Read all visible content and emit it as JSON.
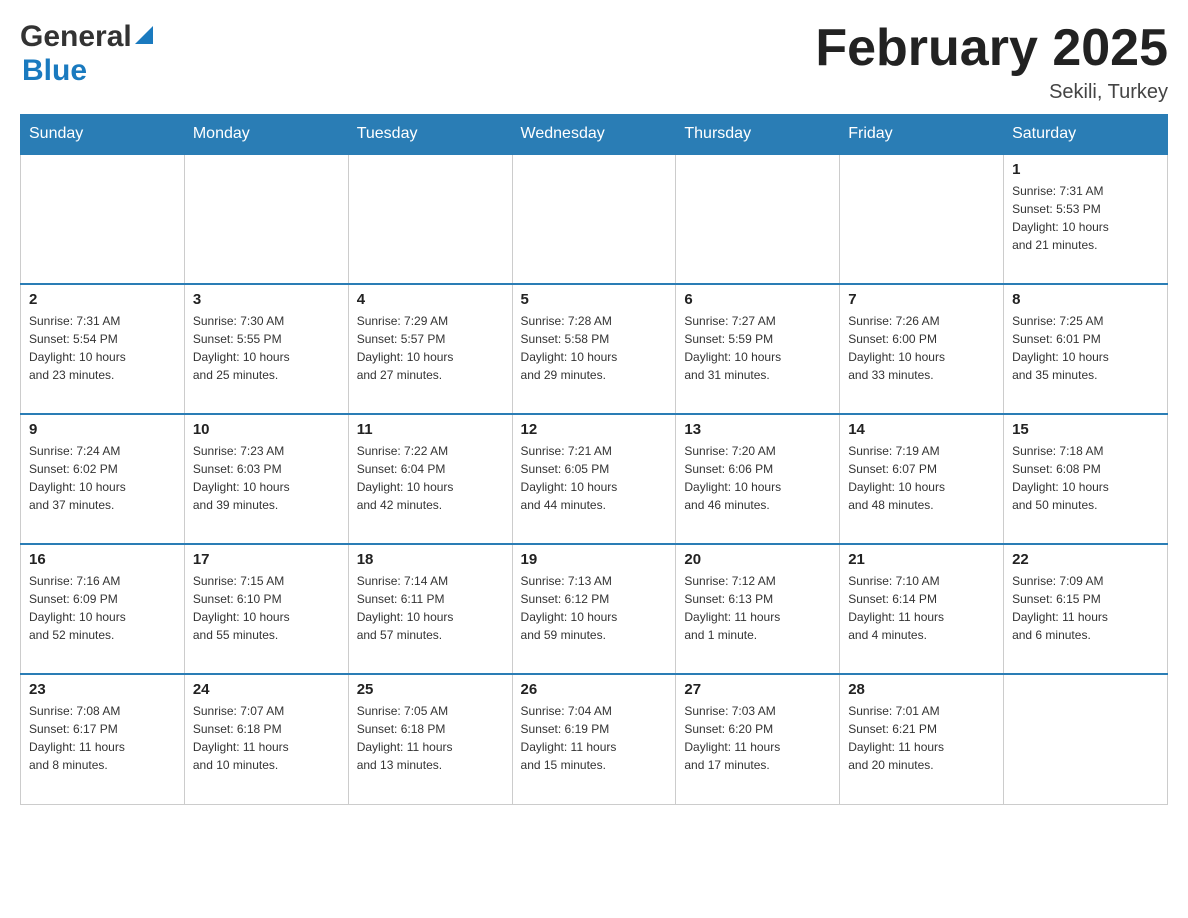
{
  "header": {
    "logo": {
      "general": "General",
      "blue": "Blue"
    },
    "title": "February 2025",
    "location": "Sekili, Turkey"
  },
  "days_of_week": [
    "Sunday",
    "Monday",
    "Tuesday",
    "Wednesday",
    "Thursday",
    "Friday",
    "Saturday"
  ],
  "weeks": [
    [
      {
        "day": "",
        "info": ""
      },
      {
        "day": "",
        "info": ""
      },
      {
        "day": "",
        "info": ""
      },
      {
        "day": "",
        "info": ""
      },
      {
        "day": "",
        "info": ""
      },
      {
        "day": "",
        "info": ""
      },
      {
        "day": "1",
        "info": "Sunrise: 7:31 AM\nSunset: 5:53 PM\nDaylight: 10 hours\nand 21 minutes."
      }
    ],
    [
      {
        "day": "2",
        "info": "Sunrise: 7:31 AM\nSunset: 5:54 PM\nDaylight: 10 hours\nand 23 minutes."
      },
      {
        "day": "3",
        "info": "Sunrise: 7:30 AM\nSunset: 5:55 PM\nDaylight: 10 hours\nand 25 minutes."
      },
      {
        "day": "4",
        "info": "Sunrise: 7:29 AM\nSunset: 5:57 PM\nDaylight: 10 hours\nand 27 minutes."
      },
      {
        "day": "5",
        "info": "Sunrise: 7:28 AM\nSunset: 5:58 PM\nDaylight: 10 hours\nand 29 minutes."
      },
      {
        "day": "6",
        "info": "Sunrise: 7:27 AM\nSunset: 5:59 PM\nDaylight: 10 hours\nand 31 minutes."
      },
      {
        "day": "7",
        "info": "Sunrise: 7:26 AM\nSunset: 6:00 PM\nDaylight: 10 hours\nand 33 minutes."
      },
      {
        "day": "8",
        "info": "Sunrise: 7:25 AM\nSunset: 6:01 PM\nDaylight: 10 hours\nand 35 minutes."
      }
    ],
    [
      {
        "day": "9",
        "info": "Sunrise: 7:24 AM\nSunset: 6:02 PM\nDaylight: 10 hours\nand 37 minutes."
      },
      {
        "day": "10",
        "info": "Sunrise: 7:23 AM\nSunset: 6:03 PM\nDaylight: 10 hours\nand 39 minutes."
      },
      {
        "day": "11",
        "info": "Sunrise: 7:22 AM\nSunset: 6:04 PM\nDaylight: 10 hours\nand 42 minutes."
      },
      {
        "day": "12",
        "info": "Sunrise: 7:21 AM\nSunset: 6:05 PM\nDaylight: 10 hours\nand 44 minutes."
      },
      {
        "day": "13",
        "info": "Sunrise: 7:20 AM\nSunset: 6:06 PM\nDaylight: 10 hours\nand 46 minutes."
      },
      {
        "day": "14",
        "info": "Sunrise: 7:19 AM\nSunset: 6:07 PM\nDaylight: 10 hours\nand 48 minutes."
      },
      {
        "day": "15",
        "info": "Sunrise: 7:18 AM\nSunset: 6:08 PM\nDaylight: 10 hours\nand 50 minutes."
      }
    ],
    [
      {
        "day": "16",
        "info": "Sunrise: 7:16 AM\nSunset: 6:09 PM\nDaylight: 10 hours\nand 52 minutes."
      },
      {
        "day": "17",
        "info": "Sunrise: 7:15 AM\nSunset: 6:10 PM\nDaylight: 10 hours\nand 55 minutes."
      },
      {
        "day": "18",
        "info": "Sunrise: 7:14 AM\nSunset: 6:11 PM\nDaylight: 10 hours\nand 57 minutes."
      },
      {
        "day": "19",
        "info": "Sunrise: 7:13 AM\nSunset: 6:12 PM\nDaylight: 10 hours\nand 59 minutes."
      },
      {
        "day": "20",
        "info": "Sunrise: 7:12 AM\nSunset: 6:13 PM\nDaylight: 11 hours\nand 1 minute."
      },
      {
        "day": "21",
        "info": "Sunrise: 7:10 AM\nSunset: 6:14 PM\nDaylight: 11 hours\nand 4 minutes."
      },
      {
        "day": "22",
        "info": "Sunrise: 7:09 AM\nSunset: 6:15 PM\nDaylight: 11 hours\nand 6 minutes."
      }
    ],
    [
      {
        "day": "23",
        "info": "Sunrise: 7:08 AM\nSunset: 6:17 PM\nDaylight: 11 hours\nand 8 minutes."
      },
      {
        "day": "24",
        "info": "Sunrise: 7:07 AM\nSunset: 6:18 PM\nDaylight: 11 hours\nand 10 minutes."
      },
      {
        "day": "25",
        "info": "Sunrise: 7:05 AM\nSunset: 6:18 PM\nDaylight: 11 hours\nand 13 minutes."
      },
      {
        "day": "26",
        "info": "Sunrise: 7:04 AM\nSunset: 6:19 PM\nDaylight: 11 hours\nand 15 minutes."
      },
      {
        "day": "27",
        "info": "Sunrise: 7:03 AM\nSunset: 6:20 PM\nDaylight: 11 hours\nand 17 minutes."
      },
      {
        "day": "28",
        "info": "Sunrise: 7:01 AM\nSunset: 6:21 PM\nDaylight: 11 hours\nand 20 minutes."
      },
      {
        "day": "",
        "info": ""
      }
    ]
  ]
}
